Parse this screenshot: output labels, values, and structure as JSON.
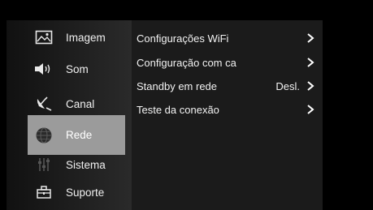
{
  "sidebar": {
    "items": [
      {
        "label": "Imagem",
        "icon": "picture-icon",
        "selected": false
      },
      {
        "label": "Som",
        "icon": "speaker-icon",
        "selected": false
      },
      {
        "label": "Canal",
        "icon": "satellite-dish-icon",
        "selected": false
      },
      {
        "label": "Rede",
        "icon": "globe-icon",
        "selected": true
      },
      {
        "label": "Sistema",
        "icon": "equalizer-icon",
        "selected": false
      },
      {
        "label": "Suporte",
        "icon": "toolbox-icon",
        "selected": false
      }
    ]
  },
  "settings": {
    "rows": [
      {
        "label": "Configurações WiFi",
        "value": ""
      },
      {
        "label": "Configuração com ca",
        "value": ""
      },
      {
        "label": "Standby em rede",
        "value": "Desl."
      },
      {
        "label": "Teste da conexão",
        "value": ""
      }
    ]
  },
  "colors": {
    "background": "#000000",
    "panel": "#1b1b1b",
    "selected_highlight": "#9b9b9b",
    "text": "#f2f2f2"
  }
}
